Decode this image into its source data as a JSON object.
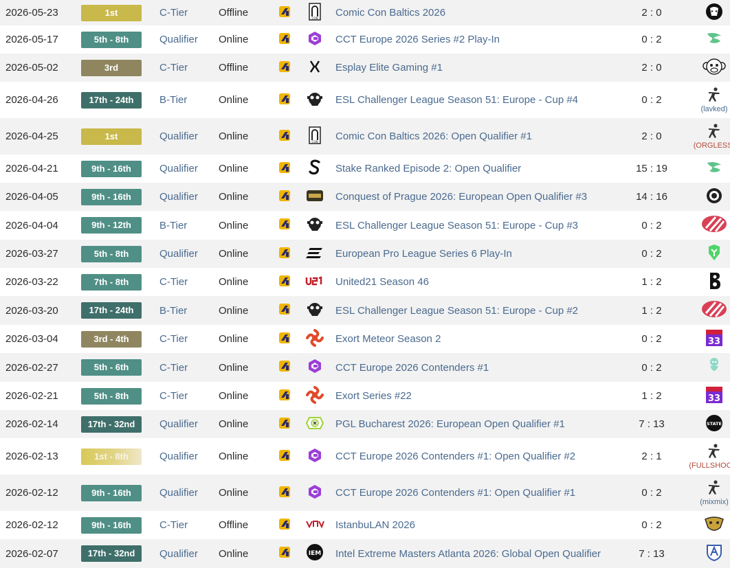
{
  "colors": {
    "link": "#4a6a8f",
    "row_alt": "#f2f2f2",
    "badge_gold": "#c9b84a",
    "badge_bronze": "#8f8660",
    "badge_teal": "#4f8f86",
    "badge_dark": "#3f6f6a",
    "note_red": "#b24a3a"
  },
  "rows": [
    {
      "date": "2026-05-23",
      "place": "1st",
      "place_style": "gold",
      "tier": "C-Tier",
      "type": "Offline",
      "tournament_icon": "comic-con-icon",
      "tournament": "Comic Con Baltics 2026",
      "score": "2 : 0",
      "opponent_icon": "skull-mask-icon",
      "opponent_note": ""
    },
    {
      "date": "2026-05-17",
      "place": "5th - 8th",
      "place_style": "teal",
      "tier": "Qualifier",
      "type": "Online",
      "tournament_icon": "cct-icon",
      "tournament": "CCT Europe 2026 Series #2 Play-In",
      "score": "0 : 2",
      "opponent_icon": "leaf-bird-icon",
      "opponent_note": ""
    },
    {
      "date": "2026-05-02",
      "place": "3rd",
      "place_style": "bronze",
      "tier": "C-Tier",
      "type": "Offline",
      "tournament_icon": "esplay-icon",
      "tournament": "Esplay Elite Gaming #1",
      "score": "2 : 0",
      "opponent_icon": "monkey-icon",
      "opponent_note": ""
    },
    {
      "date": "2026-04-26",
      "place": "17th - 24th",
      "place_style": "dark",
      "tier": "B-Tier",
      "type": "Online",
      "tournament_icon": "esl-icon",
      "tournament": "ESL Challenger League Season 51: Europe - Cup #4",
      "score": "0 : 2",
      "opponent_icon": "soldier-icon",
      "opponent_note": "(lavked)"
    },
    {
      "date": "2026-04-25",
      "place": "1st",
      "place_style": "gold",
      "tier": "Qualifier",
      "type": "Online",
      "tournament_icon": "comic-con-icon",
      "tournament": "Comic Con Baltics 2026: Open Qualifier #1",
      "score": "2 : 0",
      "opponent_icon": "soldier-icon",
      "opponent_note": "(ORGLESS)"
    },
    {
      "date": "2026-04-21",
      "place": "9th - 16th",
      "place_style": "teal",
      "tier": "Qualifier",
      "type": "Online",
      "tournament_icon": "stake-icon",
      "tournament": "Stake Ranked Episode 2: Open Qualifier",
      "score": "15 : 19",
      "opponent_icon": "leaf-bird-icon",
      "opponent_note": ""
    },
    {
      "date": "2026-04-05",
      "place": "9th - 16th",
      "place_style": "teal",
      "tier": "Qualifier",
      "type": "Online",
      "tournament_icon": "conquest-icon",
      "tournament": "Conquest of Prague 2026: European Open Qualifier #3",
      "score": "14 : 16",
      "opponent_icon": "round-emblem-icon",
      "opponent_note": ""
    },
    {
      "date": "2026-04-04",
      "place": "9th - 12th",
      "place_style": "teal",
      "tier": "B-Tier",
      "type": "Online",
      "tournament_icon": "esl-icon",
      "tournament": "ESL Challenger League Season 51: Europe - Cup #3",
      "score": "0 : 2",
      "opponent_icon": "red-stripes-icon",
      "opponent_note": ""
    },
    {
      "date": "2026-03-27",
      "place": "5th - 8th",
      "place_style": "teal",
      "tier": "Qualifier",
      "type": "Online",
      "tournament_icon": "epl-icon",
      "tournament": "European Pro League Series 6 Play-In",
      "score": "0 : 2",
      "opponent_icon": "green-shield-icon",
      "opponent_note": ""
    },
    {
      "date": "2026-03-22",
      "place": "7th - 8th",
      "place_style": "teal",
      "tier": "C-Tier",
      "type": "Online",
      "tournament_icon": "united21-icon",
      "tournament": "United21 Season 46",
      "score": "1 : 2",
      "opponent_icon": "b8-icon",
      "opponent_note": ""
    },
    {
      "date": "2026-03-20",
      "place": "17th - 24th",
      "place_style": "dark",
      "tier": "B-Tier",
      "type": "Online",
      "tournament_icon": "esl-icon",
      "tournament": "ESL Challenger League Season 51: Europe - Cup #2",
      "score": "1 : 2",
      "opponent_icon": "red-stripes-icon",
      "opponent_note": ""
    },
    {
      "date": "2026-03-04",
      "place": "3rd - 4th",
      "place_style": "bronze",
      "tier": "C-Tier",
      "type": "Online",
      "tournament_icon": "exort-icon",
      "tournament": "Exort Meteor Season 2",
      "score": "0 : 2",
      "opponent_icon": "betera-33-icon",
      "opponent_note": ""
    },
    {
      "date": "2026-02-27",
      "place": "5th - 6th",
      "place_style": "teal",
      "tier": "C-Tier",
      "type": "Online",
      "tournament_icon": "cct-icon",
      "tournament": "CCT Europe 2026 Contenders #1",
      "score": "0 : 2",
      "opponent_icon": "teal-mascot-icon",
      "opponent_note": ""
    },
    {
      "date": "2026-02-21",
      "place": "5th - 8th",
      "place_style": "teal",
      "tier": "C-Tier",
      "type": "Online",
      "tournament_icon": "exort-icon",
      "tournament": "Exort Series #22",
      "score": "1 : 2",
      "opponent_icon": "betera-33-icon",
      "opponent_note": ""
    },
    {
      "date": "2026-02-14",
      "place": "17th - 32nd",
      "place_style": "dark",
      "tier": "Qualifier",
      "type": "Online",
      "tournament_icon": "pgl-icon",
      "tournament": "PGL Bucharest 2026: European Open Qualifier #1",
      "score": "7 : 13",
      "opponent_icon": "state-icon",
      "opponent_note": ""
    },
    {
      "date": "2026-02-13",
      "place": "1st - 8th",
      "place_style": "gold-grad",
      "tier": "Qualifier",
      "type": "Online",
      "tournament_icon": "cct-icon",
      "tournament": "CCT Europe 2026 Contenders #1: Open Qualifier #2",
      "score": "2 : 1",
      "opponent_icon": "soldier-icon",
      "opponent_note": "(FULLSHOCK)"
    },
    {
      "date": "2026-02-12",
      "place": "9th - 16th",
      "place_style": "teal",
      "tier": "Qualifier",
      "type": "Online",
      "tournament_icon": "cct-icon",
      "tournament": "CCT Europe 2026 Contenders #1: Open Qualifier #1",
      "score": "0 : 2",
      "opponent_icon": "soldier-icon",
      "opponent_note": "(mixmix)"
    },
    {
      "date": "2026-02-12",
      "place": "9th - 16th",
      "place_style": "teal",
      "tier": "C-Tier",
      "type": "Offline",
      "tournament_icon": "istanbulan-icon",
      "tournament": "IstanbuLAN 2026",
      "score": "0 : 2",
      "opponent_icon": "golden-beast-icon",
      "opponent_note": ""
    },
    {
      "date": "2026-02-07",
      "place": "17th - 32nd",
      "place_style": "dark",
      "tier": "Qualifier",
      "type": "Online",
      "tournament_icon": "iem-icon",
      "tournament": "Intel Extreme Masters Atlanta 2026: Global Open Qualifier",
      "score": "7 : 13",
      "opponent_icon": "blue-shield-icon",
      "opponent_note": ""
    }
  ]
}
